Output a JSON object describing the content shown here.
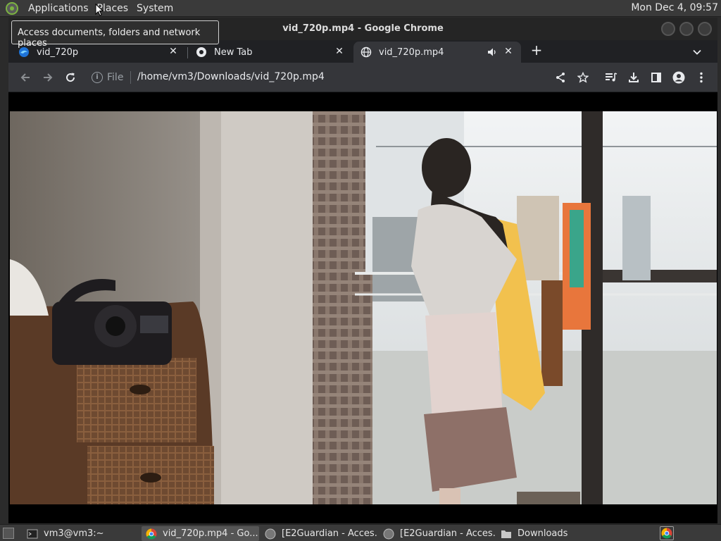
{
  "panel": {
    "menus": [
      "Applications",
      "Places",
      "System"
    ],
    "clock": "Mon Dec  4, 09:57"
  },
  "tooltip": "Access documents, folders and network places",
  "window": {
    "title": "vid_720p.mp4 - Google Chrome"
  },
  "tabs": [
    {
      "label": "vid_720p",
      "icon": "edge-icon"
    },
    {
      "label": "New Tab",
      "icon": "chrome-icon"
    },
    {
      "label": "vid_720p.mp4",
      "icon": "globe-icon",
      "audio": true
    }
  ],
  "toolbar": {
    "scheme_label": "File",
    "url": "/home/vm3/Downloads/vid_720p.mp4"
  },
  "video": {
    "scene": "video frame",
    "palette": {
      "wall": "#8c857d",
      "curtain": "#7a6a5f",
      "window_light": "#dfe3e6",
      "shirt": "#d8d4d0",
      "yellow_cloth": "#f2c14e",
      "orange_cloth": "#e8763c"
    }
  },
  "taskbar": {
    "items": [
      {
        "label": "vm3@vm3:~",
        "icon": "terminal-icon"
      },
      {
        "label": "vid_720p.mp4 - Go...",
        "icon": "chrome-icon",
        "active": true
      },
      {
        "label": "[E2Guardian - Acces...",
        "icon": "globe-icon"
      },
      {
        "label": "[E2Guardian - Acces...",
        "icon": "globe-icon"
      },
      {
        "label": "Downloads",
        "icon": "folder-icon"
      }
    ]
  }
}
